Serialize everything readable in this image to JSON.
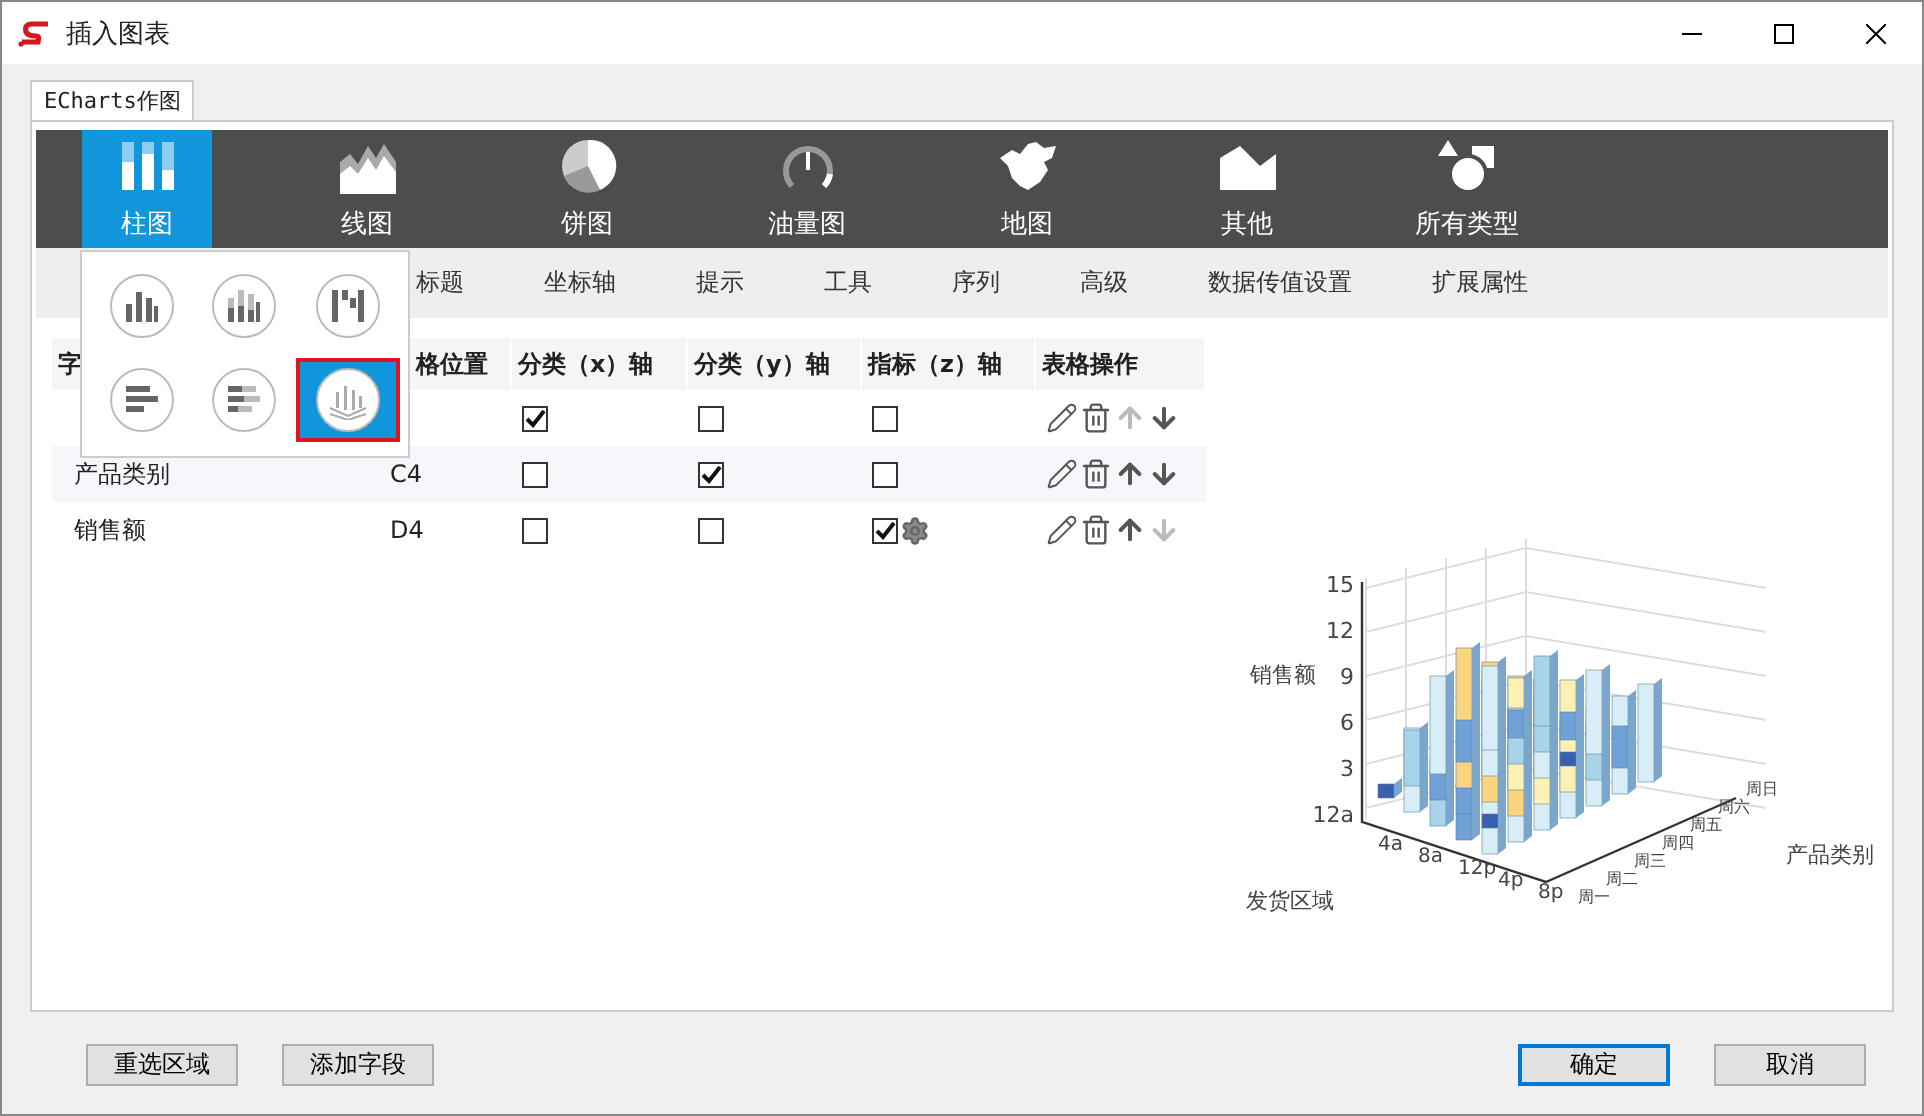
{
  "window": {
    "title": "插入图表"
  },
  "tab": {
    "label": "ECharts作图",
    "selected": true
  },
  "chart_types": [
    {
      "kind": "bar",
      "label": "柱图",
      "selected": true
    },
    {
      "kind": "line",
      "label": "线图",
      "selected": false
    },
    {
      "kind": "pie",
      "label": "饼图",
      "selected": false
    },
    {
      "kind": "gauge",
      "label": "油量图",
      "selected": false
    },
    {
      "kind": "map",
      "label": "地图",
      "selected": false
    },
    {
      "kind": "other",
      "label": "其他",
      "selected": false
    },
    {
      "kind": "all",
      "label": "所有类型",
      "selected": false
    }
  ],
  "settings_tabs": [
    "标题",
    "坐标轴",
    "提示",
    "工具",
    "序列",
    "高级",
    "数据传值设置",
    "扩展属性"
  ],
  "subtype_popup": [
    {
      "kind": "bar",
      "selected": false
    },
    {
      "kind": "bar-stacked",
      "selected": false
    },
    {
      "kind": "waterfall",
      "selected": false
    },
    {
      "kind": "hbar",
      "selected": false
    },
    {
      "kind": "hbar-stacked",
      "selected": false
    },
    {
      "kind": "bar3d",
      "selected": true
    }
  ],
  "table": {
    "columns": [
      "字",
      "格位置",
      "分类（x）轴",
      "分类（y）轴",
      "指标（z）轴",
      "表格操作"
    ],
    "rows": [
      {
        "x_axis": true,
        "y_axis": false,
        "z_axis": false,
        "z_settings": false,
        "up_disabled": true,
        "down_disabled": false
      },
      {
        "field": "产品类别",
        "cell": "C4",
        "x_axis": false,
        "y_axis": true,
        "z_axis": false,
        "z_settings": false,
        "up_disabled": false,
        "down_disabled": false
      },
      {
        "field": "销售额",
        "cell": "D4",
        "x_axis": false,
        "y_axis": false,
        "z_axis": true,
        "z_settings": true,
        "up_disabled": false,
        "down_disabled": true
      }
    ]
  },
  "preview": {
    "ylabel": "销售额",
    "yticks": [
      "15",
      "12",
      "9",
      "6",
      "3",
      "12a"
    ],
    "xticks": [
      "4a",
      "8a",
      "12p",
      "4p",
      "8p"
    ],
    "xlabel": "发货区域",
    "zticks": [
      "周一",
      "周二",
      "周三",
      "周四",
      "周五",
      "周六",
      "周日"
    ],
    "zlabel": "产品类别"
  },
  "buttons_left": [
    "重选区域",
    "添加字段"
  ],
  "buttons_right": [
    {
      "label": "确定",
      "focused": true
    },
    {
      "label": "取消",
      "focused": false
    }
  ]
}
